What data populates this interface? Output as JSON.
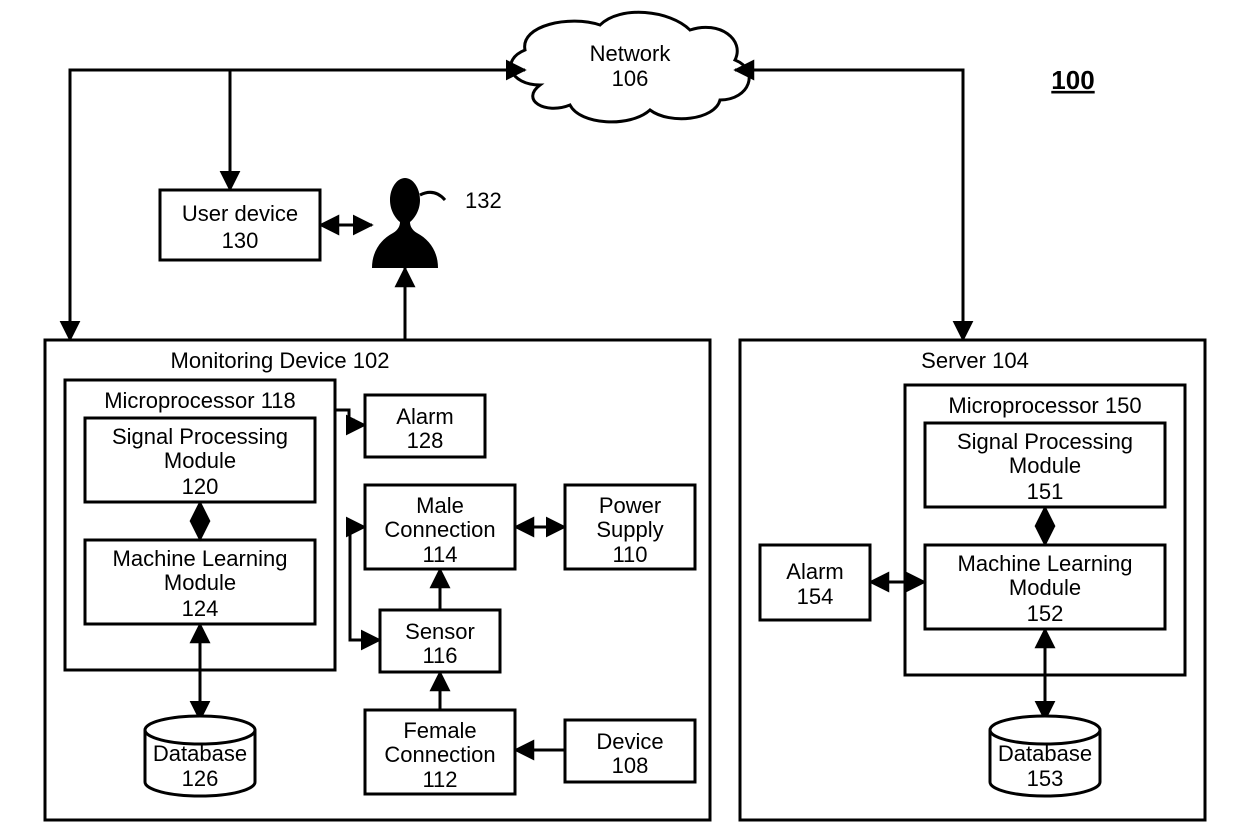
{
  "fig_ref": "100",
  "network": {
    "name": "Network",
    "num": "106"
  },
  "user_device": {
    "name": "User device",
    "num": "130"
  },
  "user": {
    "num": "132"
  },
  "monitoring_device": {
    "name": "Monitoring Device",
    "num": "102"
  },
  "microprocessor_a": {
    "name": "Microprocessor",
    "num": "118"
  },
  "sig_proc_a": {
    "name": "Signal Processing Module",
    "num": "120"
  },
  "ml_a": {
    "name": "Machine Learning Module",
    "num": "124"
  },
  "database_a": {
    "name": "Database",
    "num": "126"
  },
  "alarm_a": {
    "name": "Alarm",
    "num": "128"
  },
  "male_conn": {
    "name": "Male Connection",
    "num": "114"
  },
  "sensor": {
    "name": "Sensor",
    "num": "116"
  },
  "female_conn": {
    "name": "Female Connection",
    "num": "112"
  },
  "power_supply": {
    "name": "Power Supply",
    "num": "110"
  },
  "device": {
    "name": "Device",
    "num": "108"
  },
  "server": {
    "name": "Server",
    "num": "104"
  },
  "microprocessor_b": {
    "name": "Microprocessor",
    "num": "150"
  },
  "sig_proc_b": {
    "name": "Signal Processing Module",
    "num": "151"
  },
  "ml_b": {
    "name": "Machine Learning Module",
    "num": "152"
  },
  "database_b": {
    "name": "Database",
    "num": "153"
  },
  "alarm_b": {
    "name": "Alarm",
    "num": "154"
  }
}
